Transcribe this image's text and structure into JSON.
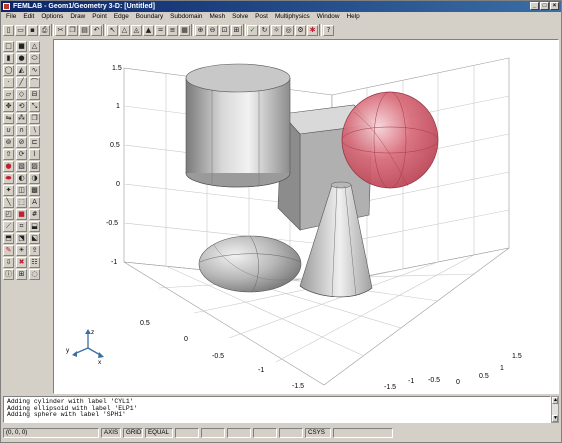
{
  "window": {
    "title": "FEMLAB - Geom1/Geometry 3-D: [Untitled]"
  },
  "menu": [
    "File",
    "Edit",
    "Options",
    "Draw",
    "Point",
    "Edge",
    "Boundary",
    "Subdomain",
    "Mesh",
    "Solve",
    "Post",
    "Multiphysics",
    "Window",
    "Help"
  ],
  "axes": {
    "z_ticks": [
      "1.5",
      "1",
      "0.5",
      "0",
      "-0.5",
      "-1"
    ],
    "x_ticks": [
      "0.5",
      "0",
      "-0.5",
      "-1",
      "-1.5"
    ],
    "y_ticks": [
      "1.5",
      "1",
      "0.5",
      "0",
      "-0.5",
      "-1",
      "-1.5"
    ],
    "triad": {
      "x": "x",
      "y": "y",
      "z": "z"
    }
  },
  "colors": {
    "sphere": "#d86a78",
    "solid": "#a9a9a9",
    "grid": "#c8c8c8"
  },
  "command_log": [
    "Adding cylinder with label 'CYL1'",
    "Adding ellipsoid with label 'ELP1'",
    "Adding sphere with label 'SPH1'"
  ],
  "status": {
    "coords": "(0, 0, 0)",
    "axis": "AXIS",
    "grid": "GRID",
    "equal": "EQUAL",
    "csys": "CSYS"
  }
}
